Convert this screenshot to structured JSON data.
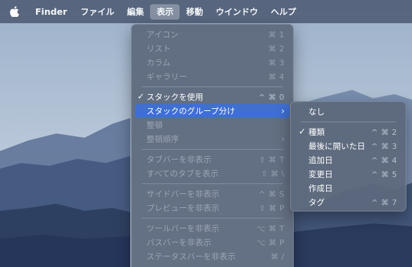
{
  "menubar": {
    "apple_icon": "apple-logo-icon",
    "app_name": "Finder",
    "items": [
      "ファイル",
      "編集",
      "表示",
      "移動",
      "ウインドウ",
      "ヘルプ"
    ],
    "active_index": 2
  },
  "view_menu": {
    "items": [
      {
        "label": "アイコン",
        "shortcut": "⌘ 1"
      },
      {
        "label": "リスト",
        "shortcut": "⌘ 2"
      },
      {
        "label": "カラム",
        "shortcut": "⌘ 3"
      },
      {
        "label": "ギャラリー",
        "shortcut": "⌘ 4"
      },
      {
        "label": "スタックを使用",
        "shortcut": "^ ⌘ 0"
      },
      {
        "label": "スタックのグループ分け",
        "shortcut": ""
      },
      {
        "label": "整頓",
        "shortcut": ""
      },
      {
        "label": "整頓順序",
        "shortcut": ""
      },
      {
        "label": "タブバーを非表示",
        "shortcut": "⇧ ⌘ T"
      },
      {
        "label": "すべてのタブを表示",
        "shortcut": "⇧ ⌘ \\"
      },
      {
        "label": "サイドバーを非表示",
        "shortcut": "^ ⌘ S"
      },
      {
        "label": "プレビューを非表示",
        "shortcut": "⇧ ⌘ P"
      },
      {
        "label": "ツールバーを非表示",
        "shortcut": "⌥ ⌘ T"
      },
      {
        "label": "パスバーを非表示",
        "shortcut": "⌥ ⌘ P"
      },
      {
        "label": "ステータスバーを非表示",
        "shortcut": "⌘ /"
      }
    ],
    "checkmark": "✓",
    "submenu_arrow": "›"
  },
  "group_submenu": {
    "items": [
      {
        "label": "なし",
        "shortcut": ""
      },
      {
        "label": "種類",
        "shortcut": "^ ⌘ 2"
      },
      {
        "label": "最後に開いた日",
        "shortcut": "^ ⌘ 3"
      },
      {
        "label": "追加日",
        "shortcut": "^ ⌘ 4"
      },
      {
        "label": "変更日",
        "shortcut": "^ ⌘ 5"
      },
      {
        "label": "作成日",
        "shortcut": ""
      },
      {
        "label": "タグ",
        "shortcut": "^ ⌘ 7"
      }
    ],
    "checkmark": "✓"
  }
}
